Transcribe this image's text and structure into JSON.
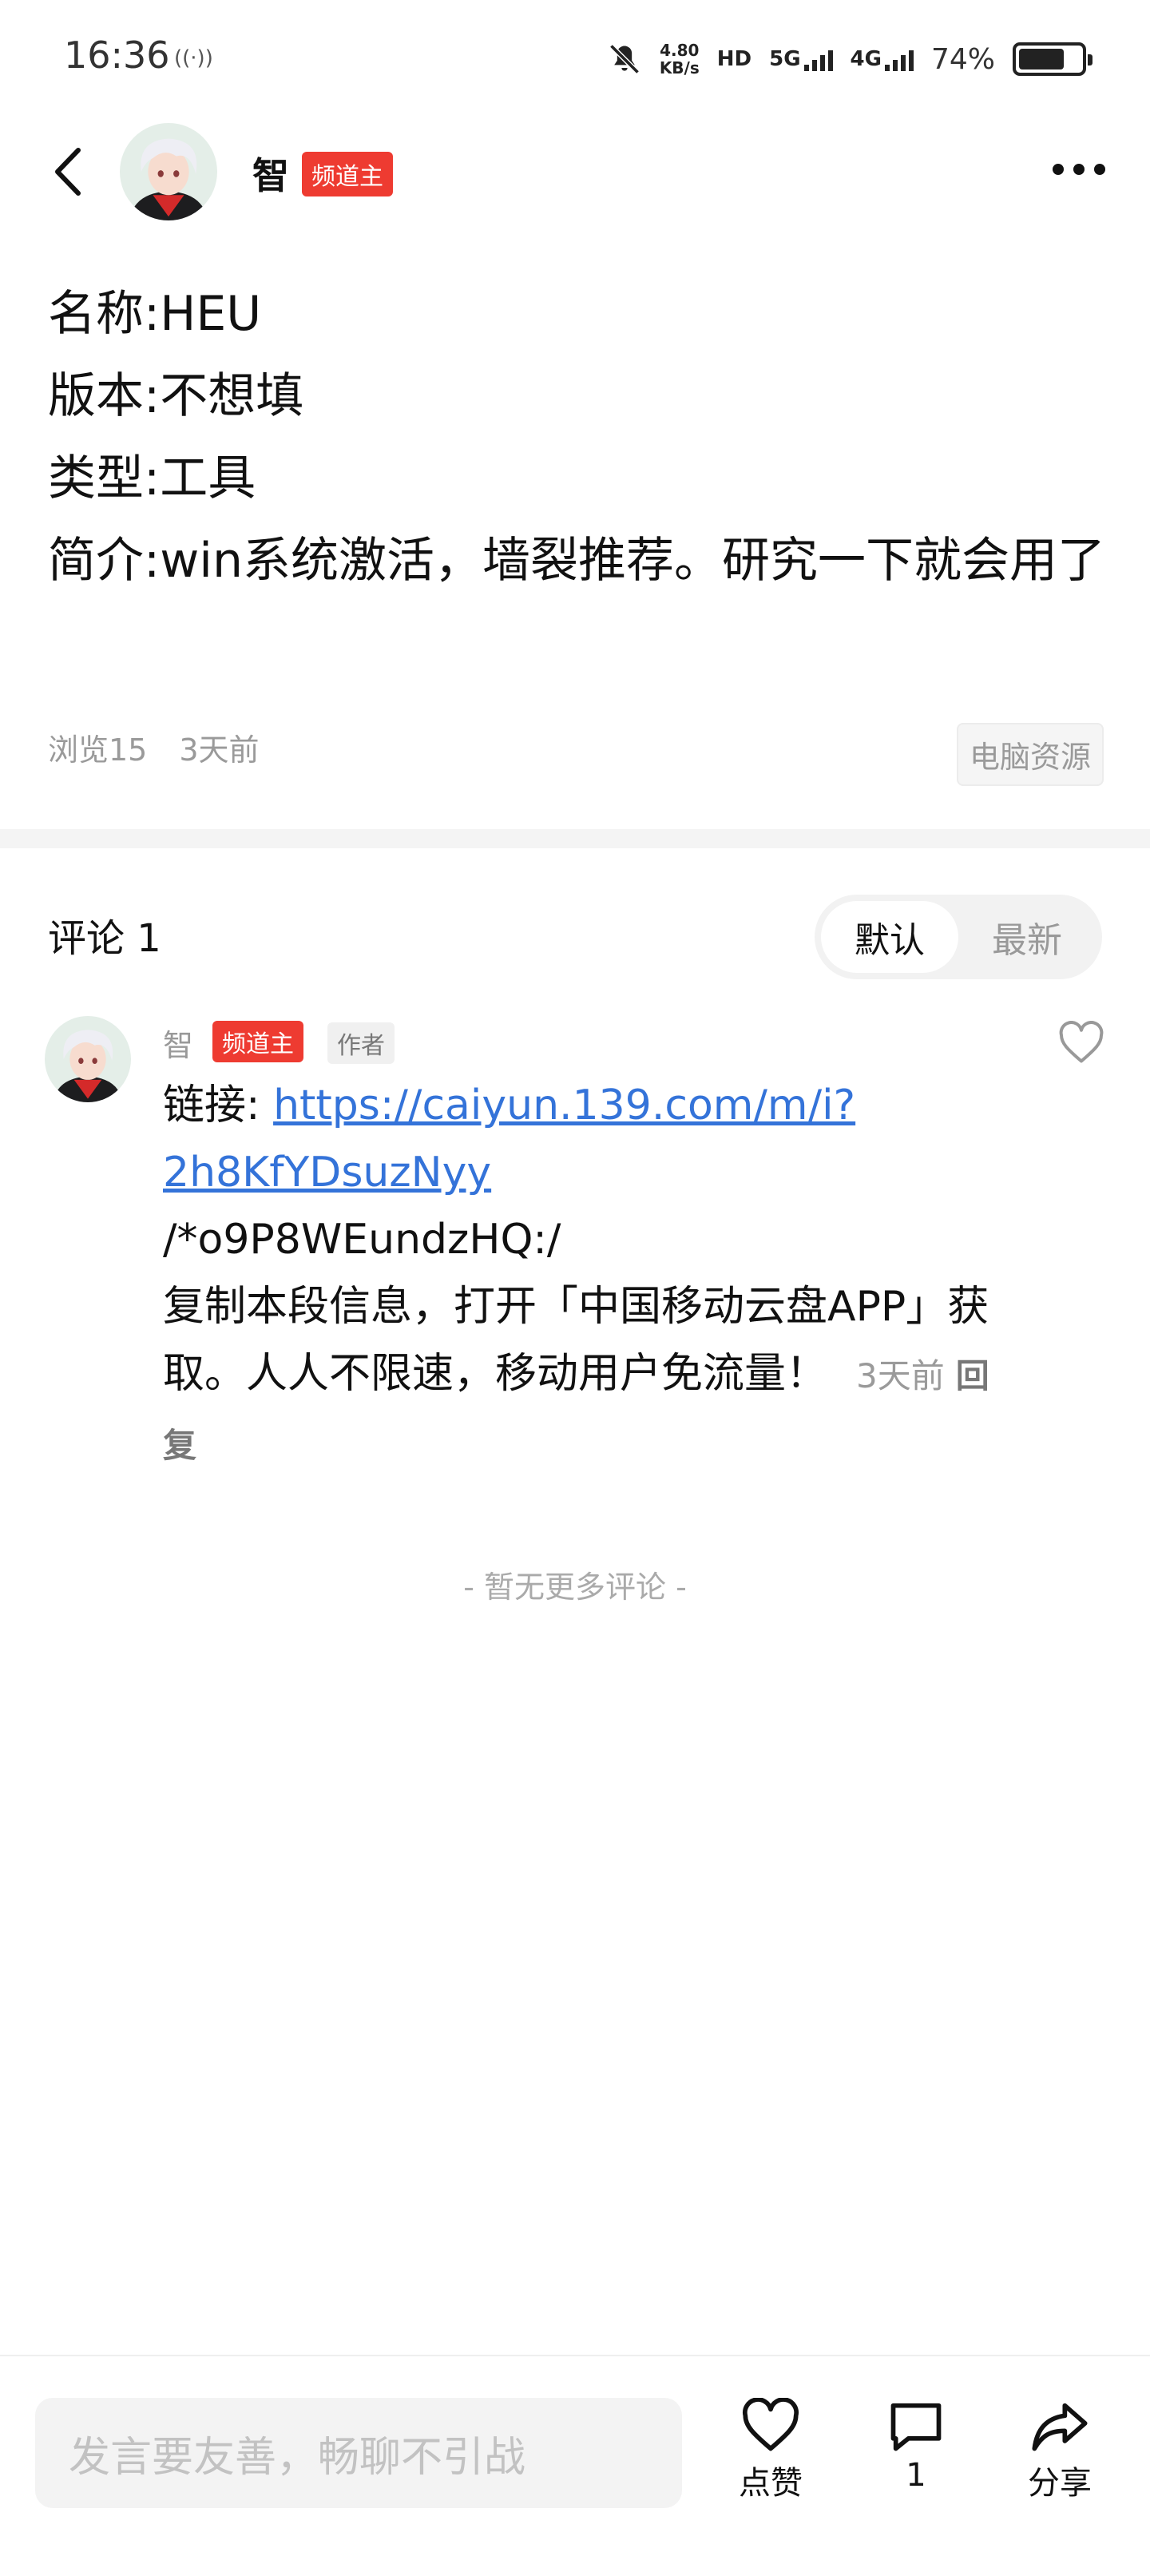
{
  "status_bar": {
    "time": "16:36",
    "radio_icon": "((·))",
    "net_speed_value": "4.80",
    "net_speed_unit": "KB/s",
    "hd_label": "HD",
    "net1": "5G",
    "net2": "4G",
    "battery_percent": "74%",
    "battery_level": 0.74
  },
  "header": {
    "author_name": "智",
    "author_badge": "频道主"
  },
  "post": {
    "lines": [
      "名称:HEU",
      "版本:不想填",
      "类型:工具",
      "简介:win系统激活，墙裂推荐。研究一下就会用了"
    ],
    "views": "浏览15",
    "time": "3天前",
    "category_tag": "电脑资源"
  },
  "comments": {
    "count_label": "评论 1",
    "sort_default": "默认",
    "sort_latest": "最新",
    "items": [
      {
        "name": "智",
        "badge": "频道主",
        "author_tag": "作者",
        "link_prefix": "链接: ",
        "link": "https://caiyun.139.com/m/i?2h8KfYDsuzNyy",
        "code": "/*o9P8WEundzHQ:/",
        "text": "复制本段信息，打开「中国移动云盘APP」获取。人人不限速，移动用户免流量！",
        "time": "3天前",
        "reply": "回复"
      }
    ],
    "no_more": "- 暂无更多评论 -"
  },
  "bottom_bar": {
    "input_placeholder": "发言要友善，畅聊不引战",
    "like_label": "点赞",
    "comment_count": "1",
    "share_label": "分享"
  },
  "colors": {
    "accent_red": "#ee3b31",
    "link_blue": "#3473d9"
  }
}
